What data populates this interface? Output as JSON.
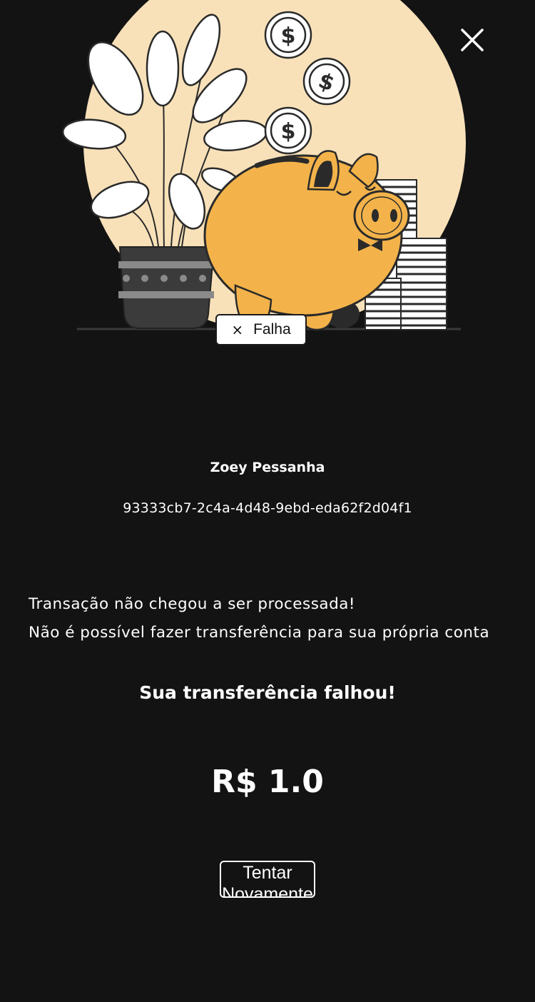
{
  "header": {
    "close_icon": "close-icon"
  },
  "illustration": {
    "subject": "piggy-bank-illustration",
    "colors": {
      "moon": "#f8e1b9",
      "piggy": "#f3b34a",
      "outline": "#2a2a2a",
      "pot": "#3b3b3b"
    }
  },
  "status": {
    "icon": "x-icon",
    "label": "Falha"
  },
  "recipient": {
    "name": "Zoey Pessanha",
    "id": "93333cb7-2c4a-4d48-9ebd-eda62f2d04f1"
  },
  "errors": {
    "line1": "Transação não chegou a ser processada!",
    "line2": "Não é possível fazer transferência para sua própria conta"
  },
  "result": {
    "title": "Sua transferência falhou!",
    "amount": "R$ 1.0"
  },
  "actions": {
    "retry_label": "Tentar Novamente"
  },
  "colors": {
    "background": "#131313",
    "text": "#ffffff"
  }
}
